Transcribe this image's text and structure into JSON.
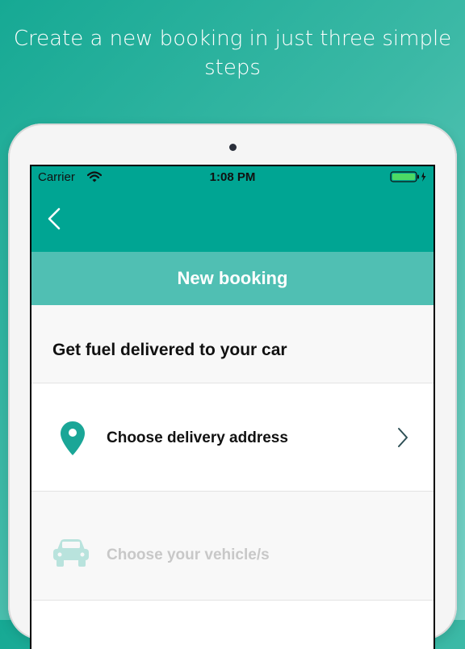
{
  "headline": "Create a new booking in just three simple steps",
  "status_bar": {
    "carrier": "Carrier",
    "time": "1:08 PM"
  },
  "icons": {
    "wifi": "wifi-icon",
    "battery": "battery-charging-icon",
    "back": "chevron-left-icon",
    "pin": "map-pin-icon",
    "chevron": "chevron-right-icon",
    "car": "car-icon"
  },
  "screen": {
    "title": "New booking",
    "section_title": "Get fuel delivered to your car",
    "steps": [
      {
        "label": "Choose delivery address",
        "enabled": true
      },
      {
        "label": "Choose your vehicle/s",
        "enabled": false
      }
    ]
  },
  "colors": {
    "accent": "#00a593",
    "title_bar": "#50bfb3",
    "pin": "#1aa697",
    "car_disabled": "#b9e3dd"
  }
}
